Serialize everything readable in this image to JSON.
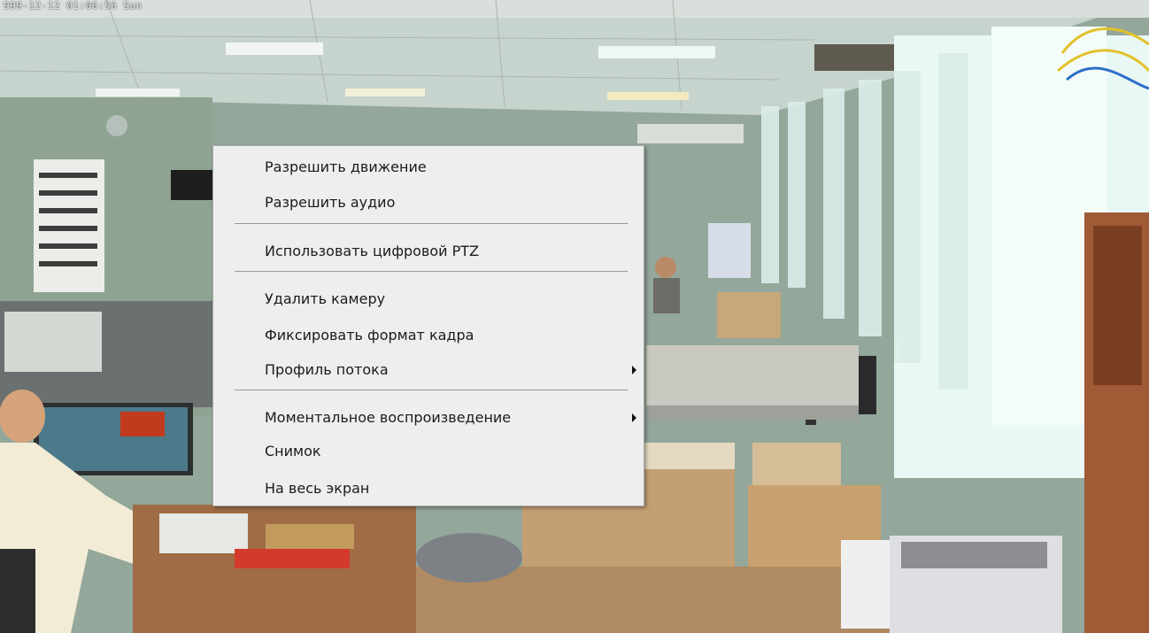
{
  "overlay": {
    "timestamp": "999-12-12 01:06:56 Sun"
  },
  "context_menu": {
    "items": [
      {
        "label": "Разрешить движение",
        "has_submenu": false
      },
      {
        "label": "Разрешить аудио",
        "has_submenu": false
      },
      {
        "label": "Использовать цифровой PTZ",
        "has_submenu": false
      },
      {
        "label": "Удалить камеру",
        "has_submenu": false
      },
      {
        "label": "Фиксировать формат кадра",
        "has_submenu": false
      },
      {
        "label": "Профиль потока",
        "has_submenu": true
      },
      {
        "label": "Моментальное воспроизведение",
        "has_submenu": true
      },
      {
        "label": "Снимок",
        "has_submenu": false
      },
      {
        "label": "На весь экран",
        "has_submenu": false
      }
    ]
  },
  "icons": {
    "submenu_indicator": "chevron-right-icon"
  },
  "colors": {
    "menu_background": "#eeeeee",
    "menu_border": "#a9a9a9",
    "menu_text": "#1b1b1b",
    "separator": "#9a9a9a"
  }
}
